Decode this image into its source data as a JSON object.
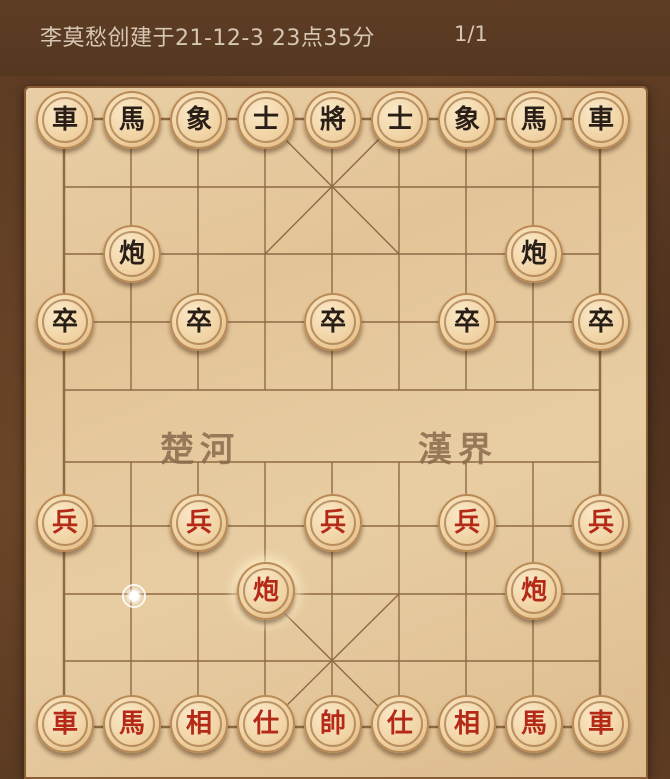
{
  "header": {
    "title": "李莫愁创建于21-12-3 23点35分",
    "page": "1/1"
  },
  "board": {
    "river_left": "楚河",
    "river_right": "漢界"
  },
  "pieces": {
    "black": [
      "車",
      "馬",
      "象",
      "士",
      "將",
      "士",
      "象",
      "馬",
      "車",
      "炮",
      "炮",
      "卒",
      "卒",
      "卒",
      "卒",
      "卒"
    ],
    "red": [
      "兵",
      "兵",
      "兵",
      "兵",
      "兵",
      "炮",
      "炮",
      "車",
      "馬",
      "相",
      "仕",
      "帥",
      "仕",
      "相",
      "馬",
      "車"
    ]
  },
  "selected_piece": "炮"
}
